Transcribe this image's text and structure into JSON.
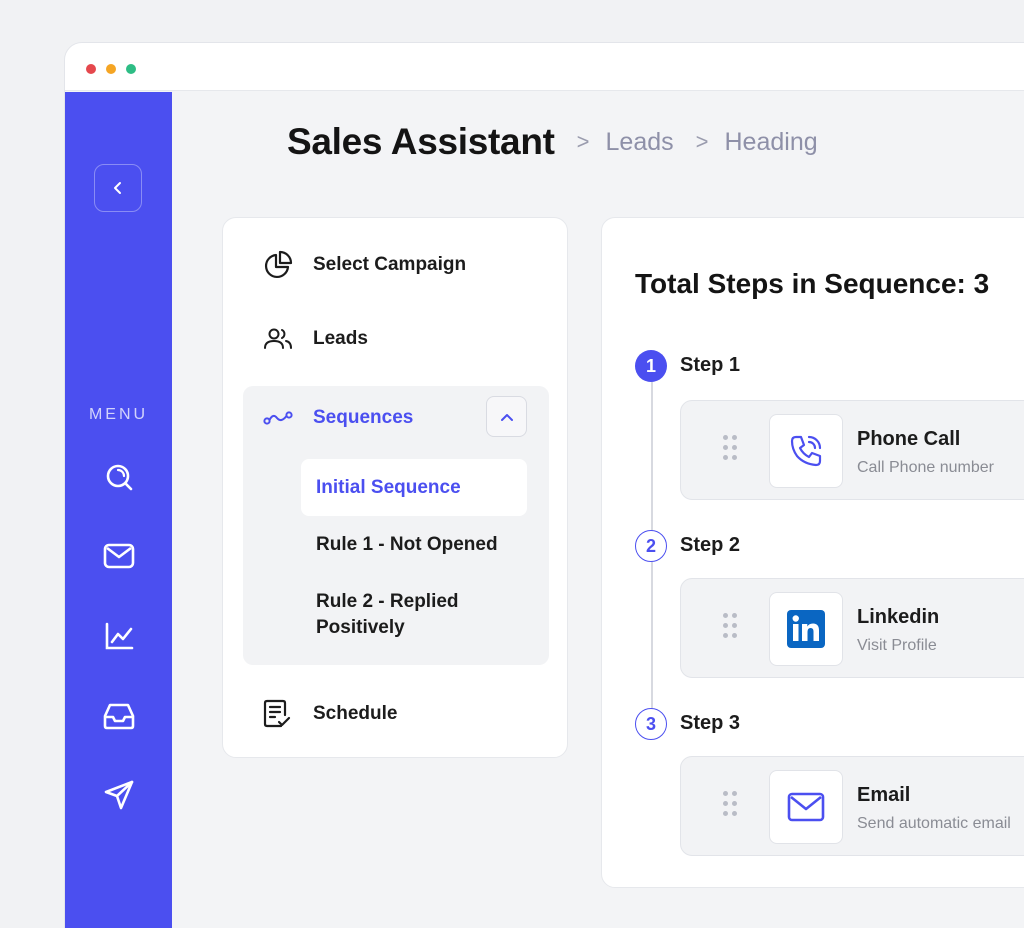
{
  "window": {
    "traffic_lights": [
      "#e5484d",
      "#f5a524",
      "#2ebd85"
    ]
  },
  "sidebar": {
    "menu_label": "MENU",
    "icons": [
      "search-icon",
      "mail-icon",
      "chart-icon",
      "inbox-icon",
      "send-icon"
    ],
    "accent": "#4b4ff0"
  },
  "header": {
    "title": "Sales Assistant",
    "separator": ">",
    "breadcrumbs": [
      "Leads",
      "Heading"
    ]
  },
  "nav": {
    "items": [
      {
        "label": "Select Campaign",
        "icon": "pie-chart-icon"
      },
      {
        "label": "Leads",
        "icon": "users-icon"
      },
      {
        "label": "Sequences",
        "icon": "sequence-icon"
      },
      {
        "label": "Schedule",
        "icon": "schedule-icon"
      }
    ],
    "sub_items": [
      {
        "label": "Initial Sequence"
      },
      {
        "label": "Rule 1 - Not Opened"
      },
      {
        "label": "Rule 2 - Replied Positively"
      }
    ]
  },
  "sequence": {
    "title": "Total Steps in Sequence: 3",
    "steps": [
      {
        "number": "1",
        "label": "Step 1",
        "name": "Phone Call",
        "desc": "Call  Phone number",
        "icon": "phone-icon"
      },
      {
        "number": "2",
        "label": "Step 2",
        "name": "Linkedin",
        "desc": "Visit Profile",
        "icon": "linkedin-icon"
      },
      {
        "number": "3",
        "label": "Step 3",
        "name": "Email",
        "desc": "Send automatic email",
        "icon": "email-icon"
      }
    ]
  }
}
